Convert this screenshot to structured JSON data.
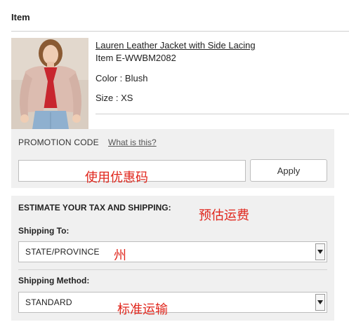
{
  "cart": {
    "section_title": "Item",
    "product": {
      "name": "Lauren Leather Jacket with Side Lacing",
      "sku": "Item E-WWBM2082",
      "color": "Color : Blush",
      "size": "Size : XS"
    }
  },
  "promo": {
    "label": "PROMOTION CODE",
    "help_link": "What is this?",
    "input_value": "",
    "input_placeholder": "",
    "note": "使用优惠码",
    "apply_label": "Apply"
  },
  "shipping": {
    "title": "ESTIMATE YOUR TAX AND SHIPPING:",
    "title_note": "预估运费",
    "to_label": "Shipping To:",
    "to_value": "STATE/PROVINCE",
    "to_note": "州",
    "method_label": "Shipping Method:",
    "method_value": "STANDARD",
    "method_note": "标准运输"
  },
  "colors": {
    "annotation": "#e0261c",
    "panel": "#f0f0f0",
    "jacket": "#dcbcb0",
    "shirt": "#c8262e",
    "jeans": "#8fb0cf"
  },
  "icons": {
    "select_arrow": "triangle-down"
  }
}
